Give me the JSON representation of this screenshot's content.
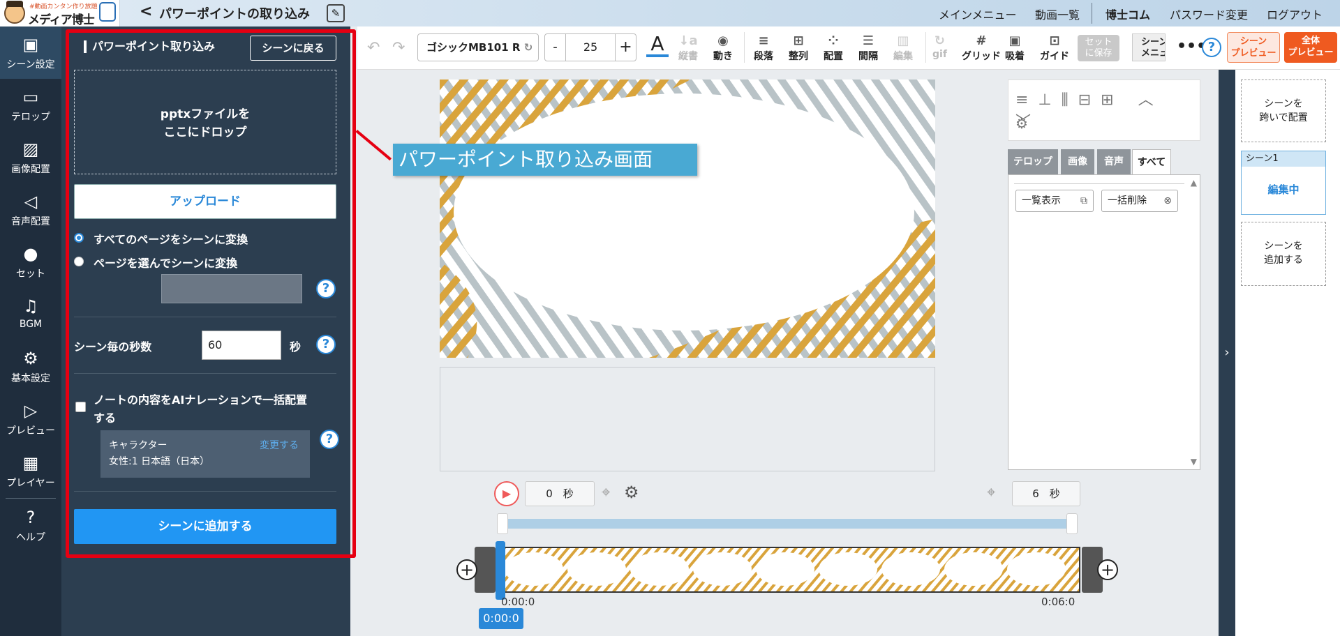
{
  "header": {
    "logo_small": "#動画カンタン作り放題",
    "logo_big": "メディア博士",
    "back_glyph": "<",
    "title": "パワーポイントの取り込み",
    "nav": [
      "メインメニュー",
      "動画一覧",
      "博士コム",
      "パスワード変更",
      "ログアウト"
    ]
  },
  "sidebar": {
    "items": [
      {
        "label": "シーン設定",
        "icon": "scene-settings-icon"
      },
      {
        "label": "テロップ",
        "icon": "telop-icon"
      },
      {
        "label": "画像配置",
        "icon": "image-icon"
      },
      {
        "label": "音声配置",
        "icon": "speaker-icon"
      },
      {
        "label": "セット",
        "icon": "set-icon"
      },
      {
        "label": "BGM",
        "icon": "music-note-icon"
      },
      {
        "label": "基本設定",
        "icon": "gear-icon"
      },
      {
        "label": "プレビュー",
        "icon": "play-icon"
      },
      {
        "label": "プレイヤー",
        "icon": "film-icon"
      },
      {
        "label": "ヘルプ",
        "icon": "help-icon"
      }
    ]
  },
  "panel": {
    "title": "パワーポイント取り込み",
    "back_button": "シーンに戻る",
    "drop_line1": "pptxファイルを",
    "drop_line2": "ここにドロップ",
    "upload_button": "アップロード",
    "radio_all": "すべてのページをシーンに変換",
    "radio_select": "ページを選んでシーンに変換",
    "seconds_label": "シーン毎の秒数",
    "seconds_value": "60",
    "seconds_unit": "秒",
    "ai_checkbox_line1": "ノートの内容をAIナレーションで一括配置",
    "ai_checkbox_line2": "する",
    "character_label": "キャラクター",
    "character_change": "変更する",
    "character_value": "女性:1 日本語（日本）",
    "add_button": "シーンに追加する"
  },
  "toolbar": {
    "font": "ゴシックMB101 R",
    "font_size": "25",
    "minus": "-",
    "plus": "+",
    "vertical": "縦書",
    "motion": "動き",
    "paragraph": "段落",
    "align": "整列",
    "arrange": "配置",
    "spacing": "間隔",
    "edit": "編集",
    "gif": "gif",
    "grid": "グリッド",
    "snap": "吸着",
    "guide": "ガイド",
    "set_save_1": "セット",
    "set_save_2": "に保存",
    "scene_menu_1": "シーン",
    "scene_menu_2": "メニュー",
    "scene_preview_1": "シーン",
    "scene_preview_2": "プレビュー",
    "all_preview_1": "全体",
    "all_preview_2": "プレビュー"
  },
  "callout": "パワーポイント取り込み画面",
  "tabs": [
    "テロップ",
    "画像",
    "音声",
    "すべて"
  ],
  "list_buttons": [
    "一覧表示",
    "一括削除"
  ],
  "timeline": {
    "start_value": "0",
    "start_unit": "秒",
    "end_value": "6",
    "end_unit": "秒",
    "label_start": "0:00:0",
    "label_end": "0:06:0",
    "current": "0:00:0"
  },
  "scenes": {
    "span_1": "シーンを",
    "span_2": "跨いで配置",
    "scene1_label": "シーン1",
    "scene1_status": "編集中",
    "add_1": "シーンを",
    "add_2": "追加する"
  },
  "colors": {
    "accent": "#2196f3",
    "panel": "#2c3e50",
    "nav": "#1f2d3d",
    "highlight": "#e60012",
    "preview": "#ef5a20"
  }
}
